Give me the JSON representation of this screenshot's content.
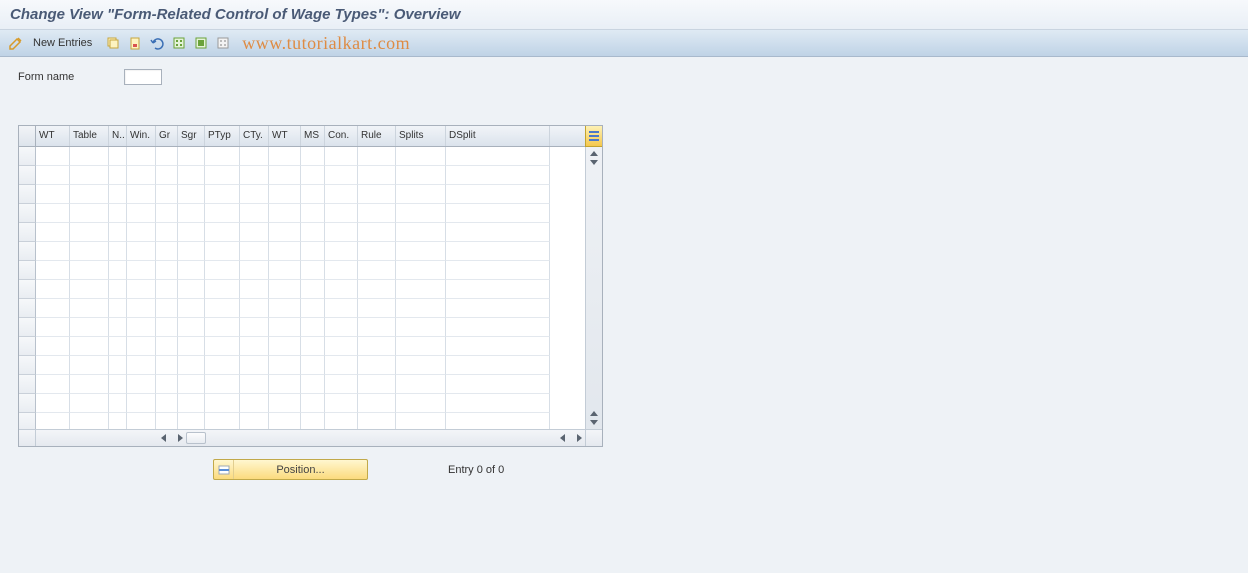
{
  "title": "Change View \"Form-Related Control of Wage Types\": Overview",
  "toolbar": {
    "new_entries": "New Entries",
    "watermark": "www.tutorialkart.com"
  },
  "form": {
    "name_label": "Form name",
    "name_value": ""
  },
  "grid": {
    "columns": [
      "WT",
      "Table",
      "N..",
      "Win.",
      "Gr",
      "Sgr",
      "PTyp",
      "CTy.",
      "WT",
      "MS",
      "Con.",
      "Rule",
      "Splits",
      "DSplit"
    ],
    "row_count": 15
  },
  "footer": {
    "position_label": "Position...",
    "entry_label": "Entry 0 of 0"
  }
}
